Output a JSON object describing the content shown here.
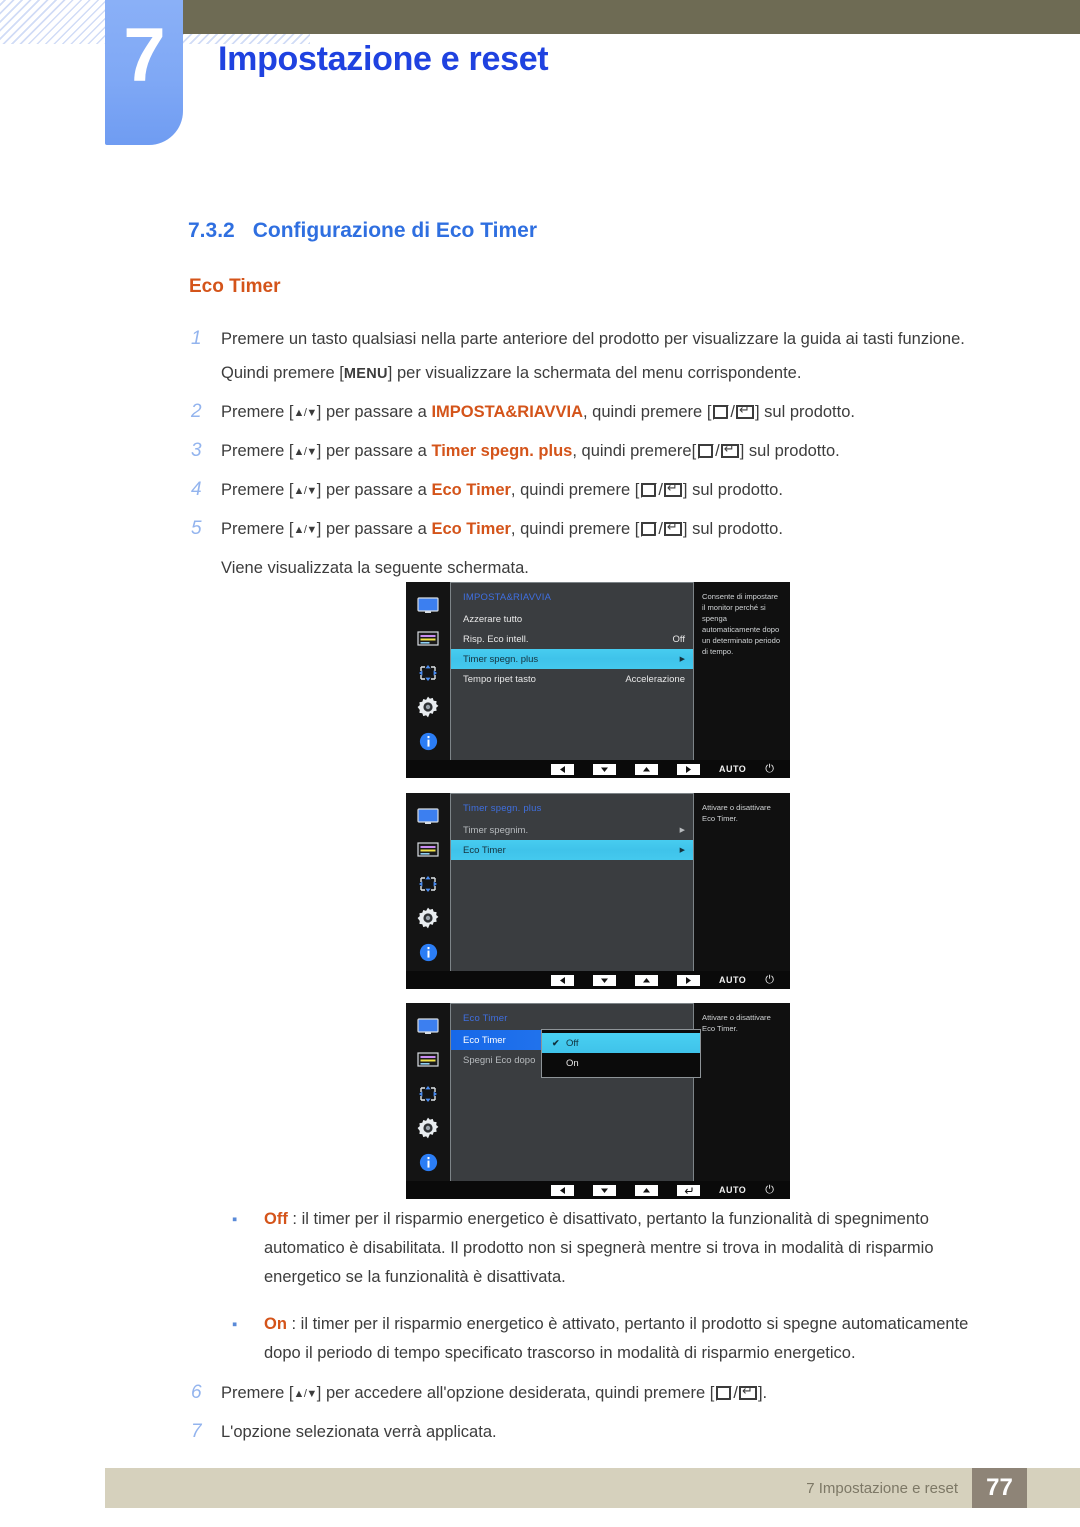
{
  "header": {
    "chapter_number": "7",
    "chapter_title": "Impostazione e reset"
  },
  "section": {
    "number": "7.3.2",
    "title": "Configurazione di Eco Timer",
    "subtitle": "Eco Timer"
  },
  "steps": [
    {
      "num": "1",
      "parts": [
        {
          "t": "text",
          "v": "Premere un tasto qualsiasi nella parte anteriore del prodotto per visualizzare la guida ai tasti funzione. Quindi premere ["
        },
        {
          "t": "menukey",
          "v": "MENU"
        },
        {
          "t": "text",
          "v": "] per visualizzare la schermata del menu corrispondente."
        }
      ]
    },
    {
      "num": "2",
      "parts": [
        {
          "t": "text",
          "v": "Premere ["
        },
        {
          "t": "updown",
          "v": "▲/▼"
        },
        {
          "t": "text",
          "v": "] per passare a "
        },
        {
          "t": "hl",
          "v": "IMPOSTA&RIAVVIA"
        },
        {
          "t": "text",
          "v": ", quindi premere ["
        },
        {
          "t": "glyph-src",
          "v": ""
        },
        {
          "t": "text",
          "v": "/"
        },
        {
          "t": "glyph-enter",
          "v": ""
        },
        {
          "t": "text",
          "v": "] sul prodotto."
        }
      ]
    },
    {
      "num": "3",
      "parts": [
        {
          "t": "text",
          "v": "Premere ["
        },
        {
          "t": "updown",
          "v": "▲/▼"
        },
        {
          "t": "text",
          "v": "] per passare a "
        },
        {
          "t": "hl",
          "v": "Timer spegn. plus"
        },
        {
          "t": "text",
          "v": ", quindi premere["
        },
        {
          "t": "glyph-src",
          "v": ""
        },
        {
          "t": "text",
          "v": "/"
        },
        {
          "t": "glyph-enter",
          "v": ""
        },
        {
          "t": "text",
          "v": "] sul prodotto."
        }
      ]
    },
    {
      "num": "4",
      "parts": [
        {
          "t": "text",
          "v": "Premere ["
        },
        {
          "t": "updown",
          "v": "▲/▼"
        },
        {
          "t": "text",
          "v": "] per passare a "
        },
        {
          "t": "hl",
          "v": "Eco Timer"
        },
        {
          "t": "text",
          "v": ", quindi premere ["
        },
        {
          "t": "glyph-src",
          "v": ""
        },
        {
          "t": "text",
          "v": "/"
        },
        {
          "t": "glyph-enter",
          "v": ""
        },
        {
          "t": "text",
          "v": "] sul prodotto."
        }
      ]
    },
    {
      "num": "5",
      "parts": [
        {
          "t": "text",
          "v": "Premere ["
        },
        {
          "t": "updown",
          "v": "▲/▼"
        },
        {
          "t": "text",
          "v": "] per passare a "
        },
        {
          "t": "hl",
          "v": "Eco Timer"
        },
        {
          "t": "text",
          "v": ", quindi premere ["
        },
        {
          "t": "glyph-src",
          "v": ""
        },
        {
          "t": "text",
          "v": "/"
        },
        {
          "t": "glyph-enter",
          "v": ""
        },
        {
          "t": "text",
          "v": "] sul prodotto."
        }
      ]
    }
  ],
  "step5_note": "Viene visualizzata la seguente schermata.",
  "osd_screens": [
    {
      "title": "IMPOSTA&RIAVVIA",
      "rows": [
        {
          "label": "Azzerare tutto",
          "value": "",
          "arrow": false,
          "state": "normal"
        },
        {
          "label": "Risp. Eco intell.",
          "value": "Off",
          "arrow": false,
          "state": "normal"
        },
        {
          "label": "Timer spegn. plus",
          "value": "",
          "arrow": true,
          "state": "sel-cyan"
        },
        {
          "label": "Tempo ripet tasto",
          "value": "Accelerazione",
          "arrow": false,
          "state": "normal"
        }
      ],
      "help": "Consente di impostare il monitor perché si spenga automaticamente dopo un determinato periodo di tempo.",
      "bar": {
        "keys": [
          "◀",
          "▼",
          "▲",
          "▶"
        ],
        "auto": "AUTO",
        "power": "⏻"
      }
    },
    {
      "title": "Timer spegn. plus",
      "rows": [
        {
          "label": "Timer spegnim.",
          "value": "",
          "arrow": true,
          "state": "dim"
        },
        {
          "label": "Eco Timer",
          "value": "",
          "arrow": true,
          "state": "sel-cyan"
        }
      ],
      "help": "Attivare o disattivare Eco Timer.",
      "bar": {
        "keys": [
          "◀",
          "▼",
          "▲",
          "▶"
        ],
        "auto": "AUTO",
        "power": "⏻"
      }
    },
    {
      "title": "Eco Timer",
      "rows": [
        {
          "label": "Eco Timer",
          "value": "",
          "arrow": false,
          "state": "sel-blue"
        },
        {
          "label": "Spegni Eco dopo",
          "value": "",
          "arrow": false,
          "state": "dim"
        }
      ],
      "dropdown": [
        {
          "label": "Off",
          "checked": true
        },
        {
          "label": "On",
          "checked": false
        }
      ],
      "help": "Attivare o disattivare Eco Timer.",
      "bar": {
        "keys": [
          "◀",
          "▼",
          "▲",
          "↵"
        ],
        "auto": "AUTO",
        "power": "⏻"
      }
    }
  ],
  "bullets": [
    {
      "dot": "▪",
      "term": "Off",
      "text": " : il timer per il risparmio energetico è disattivato, pertanto la funzionalità di spegnimento automatico è disabilitata. Il prodotto non si spegnerà mentre si trova in modalità di risparmio energetico se la funzionalità è disattivata."
    },
    {
      "dot": "▪",
      "term": "On",
      "text": " : il timer per il risparmio energetico è attivato, pertanto il prodotto si spegne automaticamente dopo il periodo di tempo specificato trascorso in modalità di risparmio energetico."
    }
  ],
  "steps_tail": [
    {
      "num": "6",
      "parts": [
        {
          "t": "text",
          "v": "Premere ["
        },
        {
          "t": "updown",
          "v": "▲/▼"
        },
        {
          "t": "text",
          "v": "] per accedere all'opzione desiderata, quindi premere ["
        },
        {
          "t": "glyph-src",
          "v": ""
        },
        {
          "t": "text",
          "v": "/"
        },
        {
          "t": "glyph-enter",
          "v": ""
        },
        {
          "t": "text",
          "v": "]."
        }
      ]
    },
    {
      "num": "7",
      "parts": [
        {
          "t": "text",
          "v": "L'opzione selezionata verrà applicata."
        }
      ]
    }
  ],
  "footer": {
    "text": "7 Impostazione e reset",
    "page": "77"
  },
  "colors": {
    "chapter_tab": "#7fa8f5",
    "header_band": "#6e6b54",
    "title_blue": "#1f42e0",
    "section_blue": "#2f6fe0",
    "accent_orange": "#d4541a",
    "footer_bar": "#d6d1bd",
    "footer_page": "#8e8477",
    "osd_highlight_cyan": "#3fc3ea",
    "osd_highlight_blue": "#1668e8"
  }
}
